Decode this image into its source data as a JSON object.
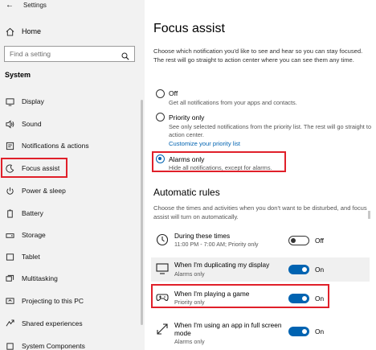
{
  "window": {
    "title": "Settings"
  },
  "sidebar": {
    "home": "Home",
    "search_placeholder": "Find a setting",
    "section": "System",
    "items": [
      {
        "label": "Display",
        "icon": "display-icon"
      },
      {
        "label": "Sound",
        "icon": "sound-icon"
      },
      {
        "label": "Notifications & actions",
        "icon": "notifications-icon"
      },
      {
        "label": "Focus assist",
        "icon": "focus-assist-moon-icon",
        "selected": true
      },
      {
        "label": "Power & sleep",
        "icon": "power-icon"
      },
      {
        "label": "Battery",
        "icon": "battery-icon"
      },
      {
        "label": "Storage",
        "icon": "storage-icon"
      },
      {
        "label": "Tablet",
        "icon": "tablet-icon"
      },
      {
        "label": "Multitasking",
        "icon": "multitasking-icon"
      },
      {
        "label": "Projecting to this PC",
        "icon": "projecting-icon"
      },
      {
        "label": "Shared experiences",
        "icon": "shared-experiences-icon"
      },
      {
        "label": "System Components",
        "icon": "system-components-icon"
      }
    ]
  },
  "main": {
    "title": "Focus assist",
    "intro": "Choose which notification you'd like to see and hear so you can stay focused. The rest will go straight to action center where you can see them any time.",
    "options": {
      "off": {
        "label": "Off",
        "desc": "Get all notifications from your apps and contacts.",
        "checked": false
      },
      "priority": {
        "label": "Priority only",
        "desc": "See only selected notifications from the priority list. The rest will go straight to action center.",
        "link": "Customize your priority list",
        "checked": false
      },
      "alarms": {
        "label": "Alarms only",
        "desc": "Hide all notifications, except for alarms.",
        "checked": true
      }
    },
    "rules_heading": "Automatic rules",
    "rules_desc": "Choose the times and activities when you don't want to be disturbed, and focus assist will turn on automatically.",
    "rules": {
      "times": {
        "name": "During these times",
        "sub": "11:00 PM - 7:00 AM; Priority only",
        "state": "Off",
        "on": false
      },
      "display": {
        "name": "When I'm duplicating my display",
        "sub": "Alarms only",
        "state": "On",
        "on": true
      },
      "game": {
        "name": "When I'm playing a game",
        "sub": "Priority only",
        "state": "On",
        "on": true
      },
      "fullscreen": {
        "name": "When I'm using an app in full screen mode",
        "sub": "Alarms only",
        "state": "On",
        "on": true
      }
    }
  },
  "colors": {
    "accent": "#0063b1",
    "highlight": "#e0202a",
    "sidebar_bg": "#f2f2f2"
  }
}
